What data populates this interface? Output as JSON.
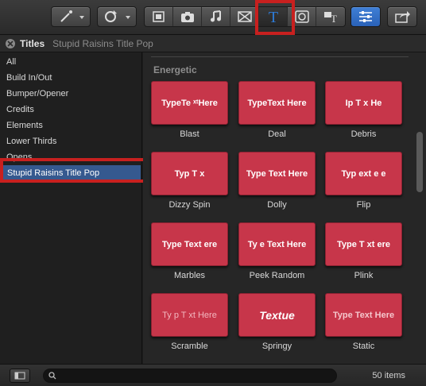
{
  "header": {
    "title": "Titles",
    "subtitle": "Stupid Raisins Title Pop"
  },
  "sidebar": {
    "items": [
      {
        "label": "All"
      },
      {
        "label": "Build In/Out"
      },
      {
        "label": "Bumper/Opener"
      },
      {
        "label": "Credits"
      },
      {
        "label": "Elements"
      },
      {
        "label": "Lower Thirds"
      },
      {
        "label": "Opens"
      },
      {
        "label": "Stupid Raisins Title Pop",
        "selected": true
      }
    ]
  },
  "browser": {
    "section": "Energetic",
    "thumb_color": "#c7364a",
    "tiles": [
      {
        "label": "Blast",
        "preview": "TypeTe ˣᵗHere"
      },
      {
        "label": "Deal",
        "preview": "TypeText Here"
      },
      {
        "label": "Debris",
        "preview": "Ip  T x   He"
      },
      {
        "label": "Dizzy Spin",
        "preview": "Typ  T x"
      },
      {
        "label": "Dolly",
        "preview": "Type Text Here"
      },
      {
        "label": "Flip",
        "preview": "Typ  ext  e e"
      },
      {
        "label": "Marbles",
        "preview": "Type Text  ere"
      },
      {
        "label": "Peek Random",
        "preview": "Ty e Text Here"
      },
      {
        "label": "Plink",
        "preview": "Type T xt  ere"
      },
      {
        "label": "Scramble",
        "preview": "Ty p T xt Here"
      },
      {
        "label": "Springy",
        "preview": "Textue"
      },
      {
        "label": "Static",
        "preview": "Type Text Here"
      }
    ]
  },
  "footer": {
    "search_placeholder": "",
    "item_count": "50 items"
  },
  "colors": {
    "highlight": "#c8201f",
    "selection": "#35598f",
    "accent_blue": "#2d7ad6"
  }
}
